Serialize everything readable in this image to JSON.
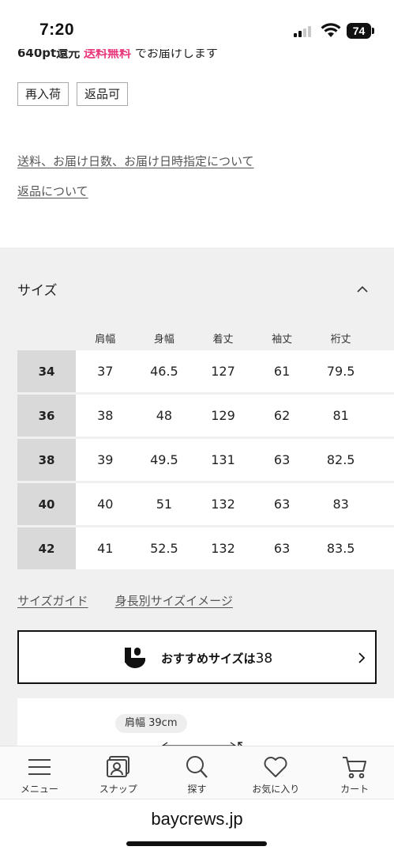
{
  "status_bar": {
    "time": "7:20",
    "battery": "74"
  },
  "product": {
    "points_text": "640pt還元",
    "free_shipping": "送料無料",
    "delivery_text": "でお届けします",
    "tags": [
      "再入荷",
      "返品可"
    ],
    "links": {
      "shipping_info": "送料、お届け日数、お届け日時指定について",
      "returns_info": "返品について"
    }
  },
  "size_section": {
    "title": "サイズ",
    "columns": [
      "肩幅",
      "身幅",
      "着丈",
      "袖丈",
      "裄丈"
    ],
    "rows": [
      {
        "size": "34",
        "values": [
          "37",
          "46.5",
          "127",
          "61",
          "79.5"
        ]
      },
      {
        "size": "36",
        "values": [
          "38",
          "48",
          "129",
          "62",
          "81"
        ]
      },
      {
        "size": "38",
        "values": [
          "39",
          "49.5",
          "131",
          "63",
          "82.5"
        ]
      },
      {
        "size": "40",
        "values": [
          "40",
          "51",
          "132",
          "63",
          "83"
        ]
      },
      {
        "size": "42",
        "values": [
          "41",
          "52.5",
          "132",
          "63",
          "83.5"
        ]
      }
    ],
    "size_guide_link": "サイズガイド",
    "height_image_link": "身長別サイズイメージ",
    "recommend": {
      "label": "おすすめサイズは",
      "size": "38"
    },
    "measure_label": "肩幅 39cm"
  },
  "bottom_nav": [
    {
      "icon": "menu-icon",
      "label": "メニュー"
    },
    {
      "icon": "snap-icon",
      "label": "スナップ"
    },
    {
      "icon": "search-icon",
      "label": "探す"
    },
    {
      "icon": "heart-icon",
      "label": "お気に入り"
    },
    {
      "icon": "cart-icon",
      "label": "カート"
    }
  ],
  "browser": {
    "url": "baycrews.jp"
  },
  "colors": {
    "accent_pink": "#e8397d",
    "section_bg": "#f0f0f0",
    "size_label_bg": "#d9d9d9"
  }
}
